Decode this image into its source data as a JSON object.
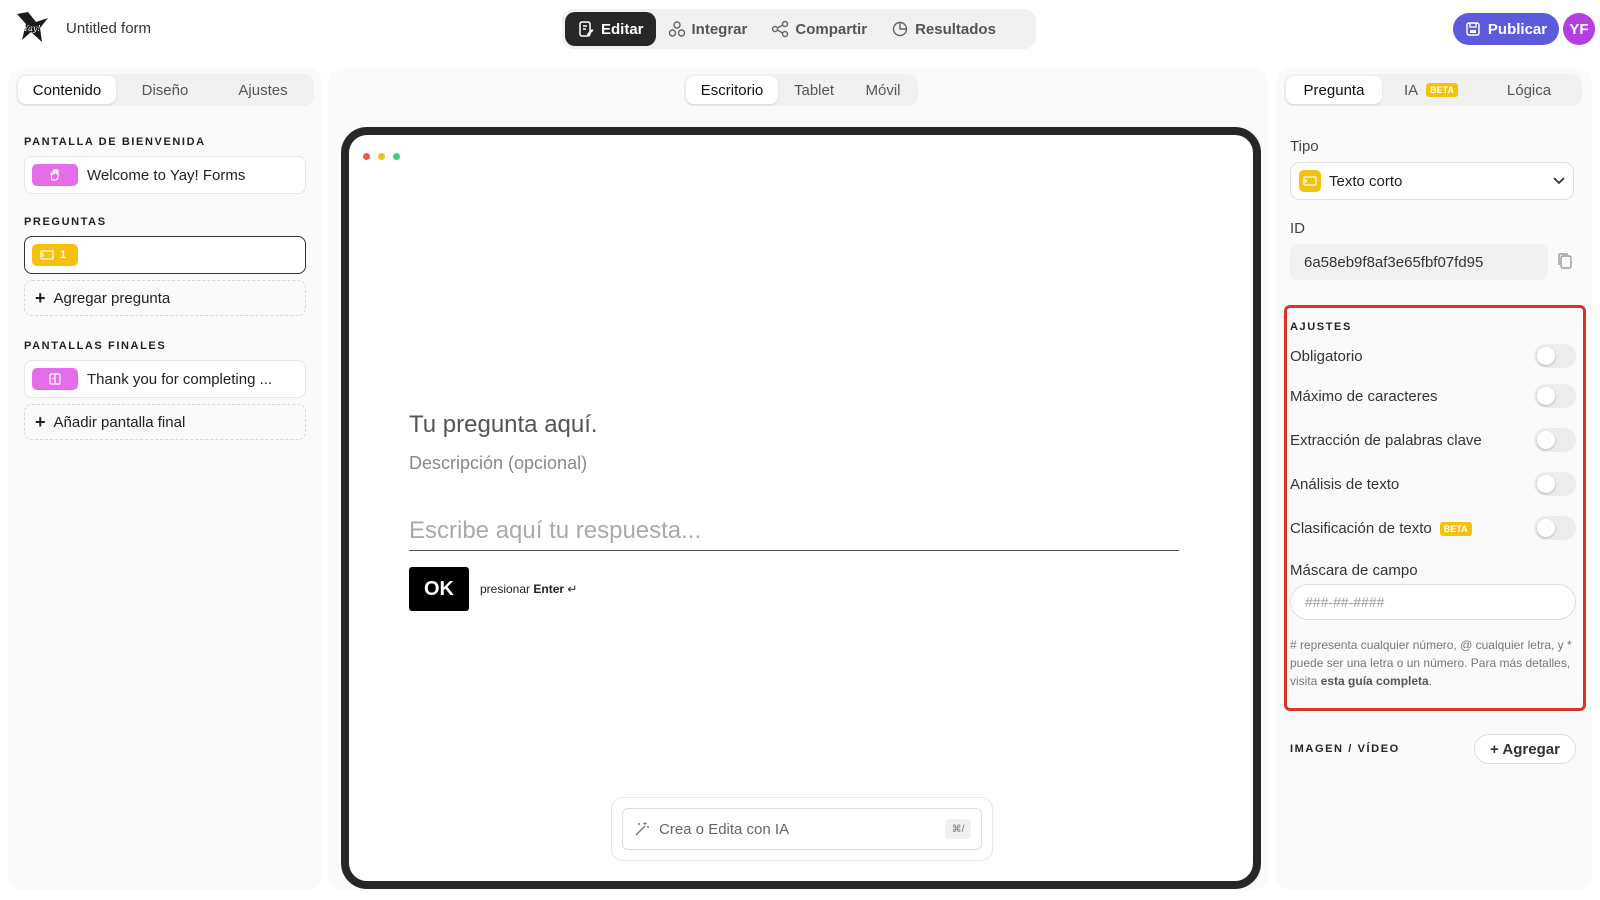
{
  "app": {
    "form_title": "Untitled form",
    "avatar_initials": "YF",
    "publish_label": "Publicar"
  },
  "main_tabs": [
    {
      "label": "Editar",
      "icon": "edit-icon",
      "active": true
    },
    {
      "label": "Integrar",
      "icon": "integrate-icon",
      "active": false
    },
    {
      "label": "Compartir",
      "icon": "share-icon",
      "active": false
    },
    {
      "label": "Resultados",
      "icon": "results-icon",
      "active": false
    }
  ],
  "left_panel": {
    "tabs": [
      "Contenido",
      "Diseño",
      "Ajustes"
    ],
    "welcome_label": "PANTALLA DE BIENVENIDA",
    "welcome_item": "Welcome to Yay! Forms",
    "questions_label": "PREGUNTAS",
    "question_number": "1",
    "add_question": "Agregar pregunta",
    "endings_label": "PANTALLAS FINALES",
    "ending_item": "Thank you for completing ...",
    "add_ending": "Añadir pantalla final"
  },
  "center": {
    "device_tabs": [
      "Escritorio",
      "Tablet",
      "Móvil"
    ],
    "question_title": "Tu pregunta aquí.",
    "question_desc": "Descripción (opcional)",
    "answer_placeholder": "Escribe aquí tu respuesta...",
    "ok_label": "OK",
    "hint_prefix": "presionar",
    "hint_key": "Enter",
    "ai_placeholder": "Crea o Edita con IA",
    "ai_shortcut": "⌘/"
  },
  "right_panel": {
    "tabs": [
      "Pregunta",
      "IA",
      "Lógica"
    ],
    "beta_badge": "BETA",
    "type_label": "Tipo",
    "type_value": "Texto corto",
    "id_label": "ID",
    "id_value": "6a58eb9f8af3e65fbf07fd95",
    "settings_title": "AJUSTES",
    "toggles": [
      {
        "label": "Obligatorio",
        "on": false
      },
      {
        "label": "Máximo de caracteres",
        "on": false
      },
      {
        "label": "Extracción de palabras clave",
        "on": false
      },
      {
        "label": "Análisis de texto",
        "on": false
      },
      {
        "label": "Clasificación de texto",
        "on": false
      }
    ],
    "mask_label": "Máscara de campo",
    "mask_placeholder": "###-##-####",
    "mask_help": "# representa cualquier número, @ cualquier letra, y * puede ser una letra o un número. Para más detalles, visita",
    "mask_help_link": "esta guía completa",
    "media_label": "IMAGEN / VÍDEO",
    "add_media": "+ Agregar"
  },
  "colors": {
    "accent": "#5b5bdc",
    "dark": "#27272a",
    "highlight": "#d8342b",
    "yellow": "#f4c20d",
    "pink": "#e26ee8"
  }
}
